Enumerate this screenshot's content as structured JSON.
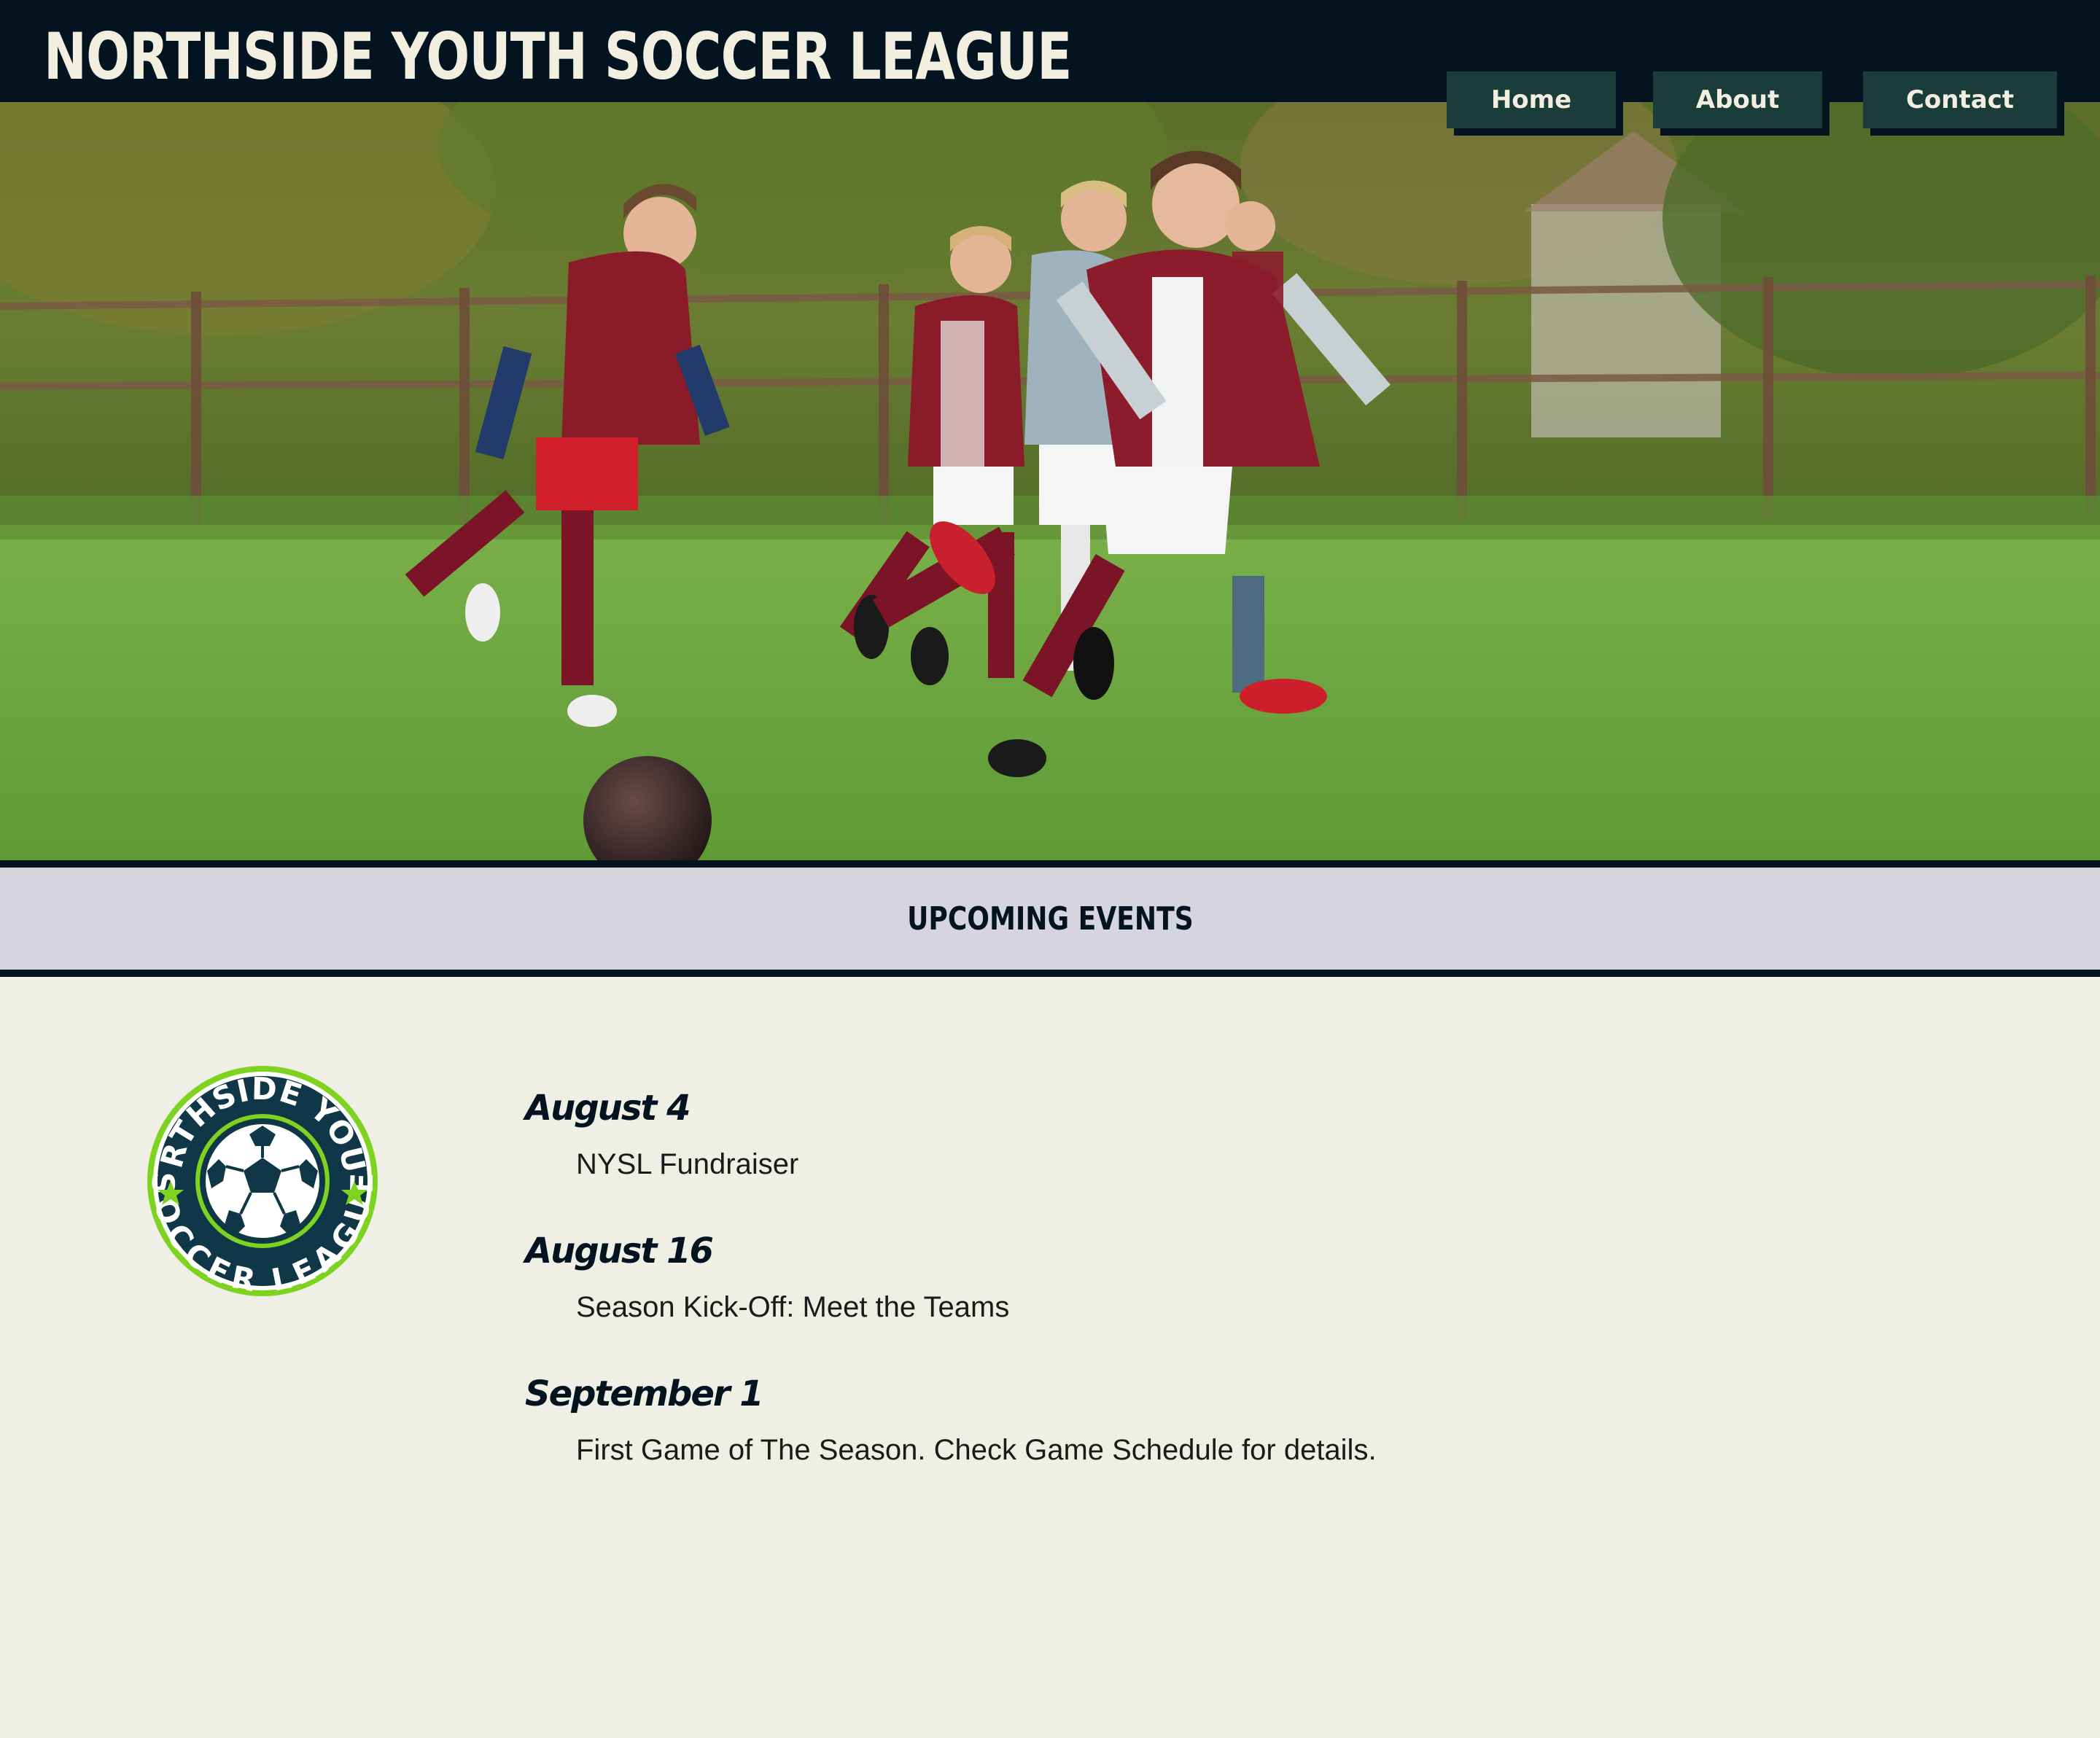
{
  "header": {
    "title": "NORTHSIDE YOUTH SOCCER LEAGUE"
  },
  "nav": {
    "items": [
      {
        "label": "Home"
      },
      {
        "label": "About"
      },
      {
        "label": "Contact"
      }
    ]
  },
  "hero": {
    "image": "kids-playing-soccer-photo"
  },
  "events_section": {
    "heading": "UPCOMING EVENTS",
    "logo": {
      "top_text": "NORTHSIDE YOUTH",
      "bottom_text": "SOCCER LEAGUE",
      "icon": "soccer-ball-icon"
    },
    "events": [
      {
        "date": "August 4",
        "description": "NYSL Fundraiser"
      },
      {
        "date": "August 16",
        "description": "Season Kick-Off: Meet the Teams"
      },
      {
        "date": "September 1",
        "description": "First Game of The Season. Check Game Schedule for details."
      }
    ]
  },
  "colors": {
    "header_bg": "#03131f",
    "nav_button_bg": "#1a3c3a",
    "banner_bg": "#d6d5df",
    "page_bg": "#f0efe5",
    "logo_green": "#7ed321"
  }
}
